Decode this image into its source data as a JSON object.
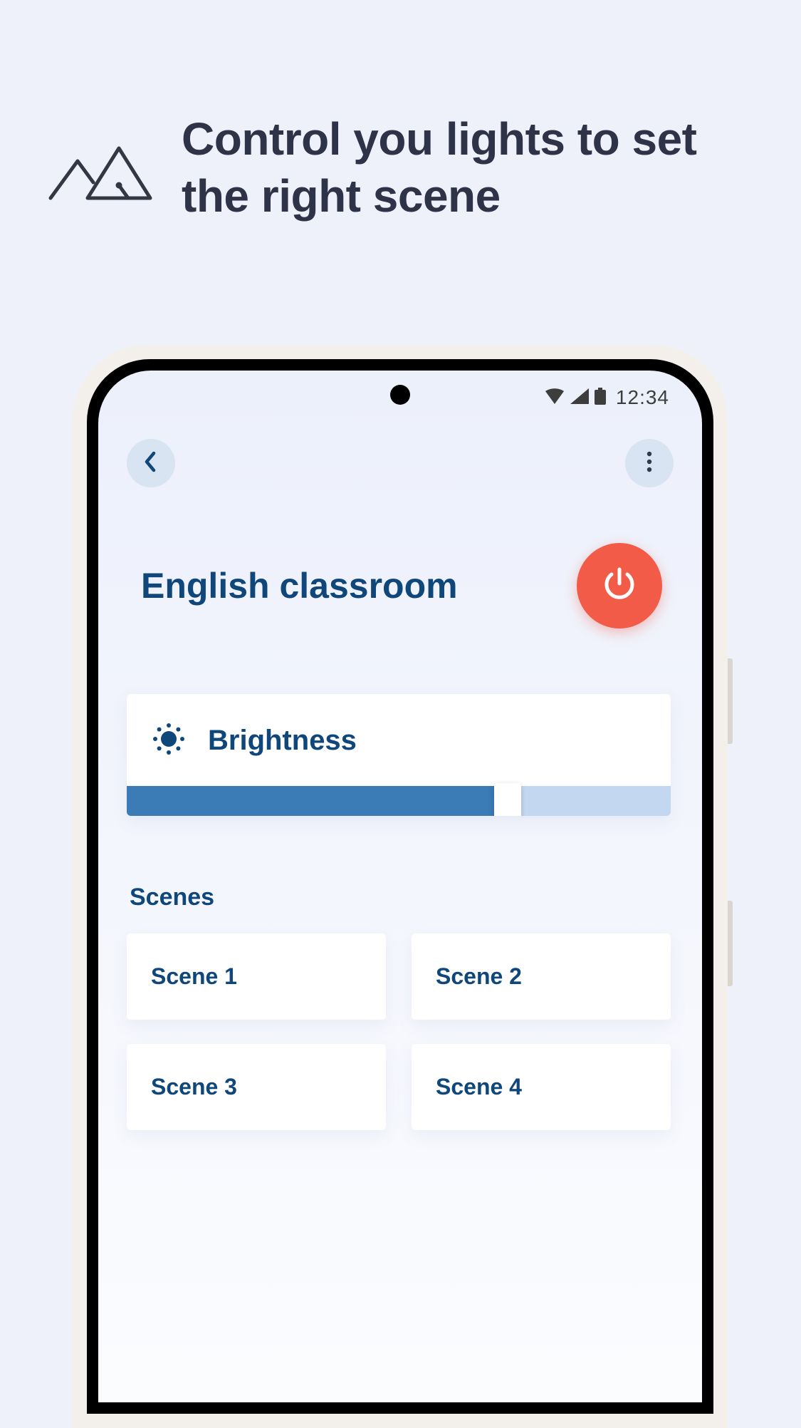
{
  "header": {
    "title": "Control you lights to set the right scene"
  },
  "status_bar": {
    "time": "12:34"
  },
  "room": {
    "name": "English classroom"
  },
  "brightness": {
    "label": "Brightness",
    "percent": 70
  },
  "scenes": {
    "title": "Scenes",
    "items": [
      {
        "label": "Scene 1"
      },
      {
        "label": "Scene 2"
      },
      {
        "label": "Scene 3"
      },
      {
        "label": "Scene 4"
      }
    ]
  },
  "colors": {
    "accent": "#10477b",
    "power": "#f25b48",
    "slider_fill": "#3b7bb6",
    "slider_track": "#c4d7f1",
    "bg": "#eef0fa"
  }
}
